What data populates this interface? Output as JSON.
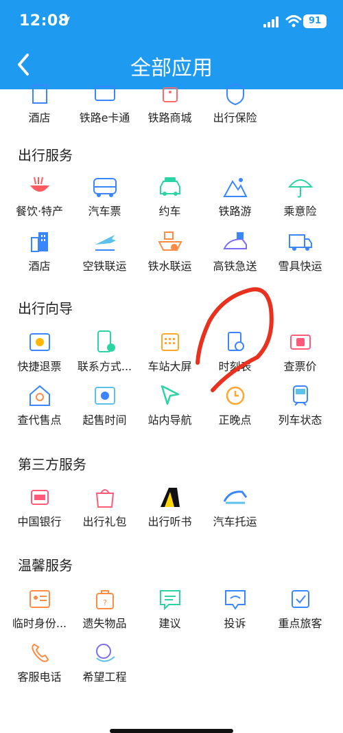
{
  "status_bar": {
    "time": "12:08",
    "battery": "91"
  },
  "header": {
    "title": "全部应用"
  },
  "top_row": [
    {
      "label": "酒店",
      "icon": "hotel-icon"
    },
    {
      "label": "铁路e卡通",
      "icon": "card-icon"
    },
    {
      "label": "铁路商城",
      "icon": "shop-icon"
    },
    {
      "label": "出行保险",
      "icon": "shield-icon"
    }
  ],
  "sections": [
    {
      "title": "出行服务",
      "apps": [
        {
          "label": "餐饮·特产",
          "icon": "noodle-icon"
        },
        {
          "label": "汽车票",
          "icon": "bus-icon"
        },
        {
          "label": "约车",
          "icon": "taxi-icon"
        },
        {
          "label": "铁路游",
          "icon": "mountain-icon"
        },
        {
          "label": "乘意险",
          "icon": "umbrella-icon"
        },
        {
          "label": "酒店",
          "icon": "hotel-icon"
        },
        {
          "label": "空铁联运",
          "icon": "plane-train-icon"
        },
        {
          "label": "铁水联运",
          "icon": "ship-icon"
        },
        {
          "label": "高铁急送",
          "icon": "express-icon"
        },
        {
          "label": "雪具快运",
          "icon": "truck-icon"
        }
      ]
    },
    {
      "title": "出行向导",
      "apps": [
        {
          "label": "快捷退票",
          "icon": "refund-ticket-icon"
        },
        {
          "label": "联系方式...",
          "icon": "phone-check-icon"
        },
        {
          "label": "车站大屏",
          "icon": "calendar-grid-icon"
        },
        {
          "label": "时刻表",
          "icon": "timetable-icon"
        },
        {
          "label": "查票价",
          "icon": "price-ticket-icon"
        },
        {
          "label": "查代售点",
          "icon": "agency-icon"
        },
        {
          "label": "起售时间",
          "icon": "sale-time-icon"
        },
        {
          "label": "站内导航",
          "icon": "navigation-icon"
        },
        {
          "label": "正晚点",
          "icon": "clock-icon"
        },
        {
          "label": "列车状态",
          "icon": "train-icon"
        }
      ]
    },
    {
      "title": "第三方服务",
      "apps": [
        {
          "label": "中国银行",
          "icon": "bank-icon"
        },
        {
          "label": "出行礼包",
          "icon": "gift-bag-icon"
        },
        {
          "label": "出行听书",
          "icon": "audiobook-icon"
        },
        {
          "label": "汽车托运",
          "icon": "car-shipping-icon"
        }
      ]
    },
    {
      "title": "温馨服务",
      "apps": [
        {
          "label": "临时身份...",
          "icon": "id-card-icon"
        },
        {
          "label": "遗失物品",
          "icon": "lost-bag-icon"
        },
        {
          "label": "建议",
          "icon": "suggestion-icon"
        },
        {
          "label": "投诉",
          "icon": "complaint-icon"
        },
        {
          "label": "重点旅客",
          "icon": "priority-passenger-icon"
        },
        {
          "label": "客服电话",
          "icon": "service-phone-icon"
        },
        {
          "label": "希望工程",
          "icon": "hope-project-icon"
        }
      ]
    }
  ],
  "colors": {
    "header": "#1e9bf0",
    "annotation": "#e8311f"
  }
}
